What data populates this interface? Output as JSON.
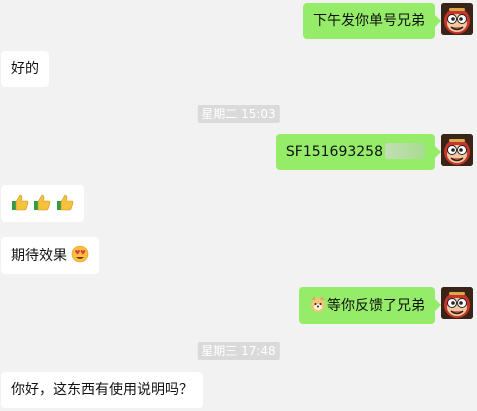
{
  "messages": [
    {
      "side": "out",
      "text": "下午发你单号兄弟"
    },
    {
      "side": "in",
      "text": "好的"
    },
    {
      "timestamp": "星期二 15:03"
    },
    {
      "side": "out",
      "text": "SF15169325​8"
    },
    {
      "side": "in",
      "emoji": [
        "thumbs-up",
        "thumbs-up",
        "thumbs-up"
      ]
    },
    {
      "side": "in",
      "text": "期待效果",
      "emoji_after": "heart-eyes"
    },
    {
      "side": "out",
      "emoji_before": "doge",
      "text": "等你反馈了兄弟"
    },
    {
      "timestamp": "星期三 17:48"
    },
    {
      "side": "in",
      "text": "你好，这东西有使用说明吗？"
    }
  ],
  "m1": {
    "text": "下午发你单号兄弟"
  },
  "m2": {
    "text": "好的"
  },
  "ts1": {
    "text": "星期二 15:03"
  },
  "m3": {
    "text": "SF15169325​8"
  },
  "m5": {
    "text": "期待效果"
  },
  "m6": {
    "text": "等你反馈了兄弟"
  },
  "ts2": {
    "text": "星期三 17:48"
  },
  "m7": {
    "text": "你好，这东西有使用说明吗？"
  },
  "colors": {
    "background": "#f2f2f2",
    "outgoing_bubble": "#95ec69",
    "incoming_bubble": "#ffffff",
    "timestamp_bg": "#dadada"
  }
}
